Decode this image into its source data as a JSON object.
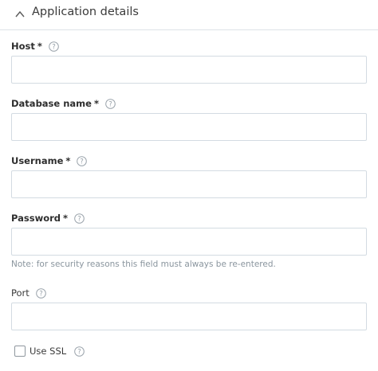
{
  "section": {
    "title": "Application details",
    "expanded": true
  },
  "fields": {
    "host": {
      "label": "Host",
      "required_marker": "*",
      "value": ""
    },
    "database_name": {
      "label": "Database name",
      "required_marker": "*",
      "value": ""
    },
    "username": {
      "label": "Username",
      "required_marker": "*",
      "value": ""
    },
    "password": {
      "label": "Password",
      "required_marker": "*",
      "value": "",
      "note": "Note: for security reasons this field must always be re-entered."
    },
    "port": {
      "label": "Port",
      "value": ""
    },
    "use_ssl": {
      "label": "Use SSL",
      "checked": false
    }
  },
  "icons": {
    "collapse": "chevron-up-icon",
    "help": "question-circle-icon"
  },
  "colors": {
    "border": "#d3dbe2",
    "help_icon": "#9aa3ab",
    "note_text": "#8a959e"
  }
}
